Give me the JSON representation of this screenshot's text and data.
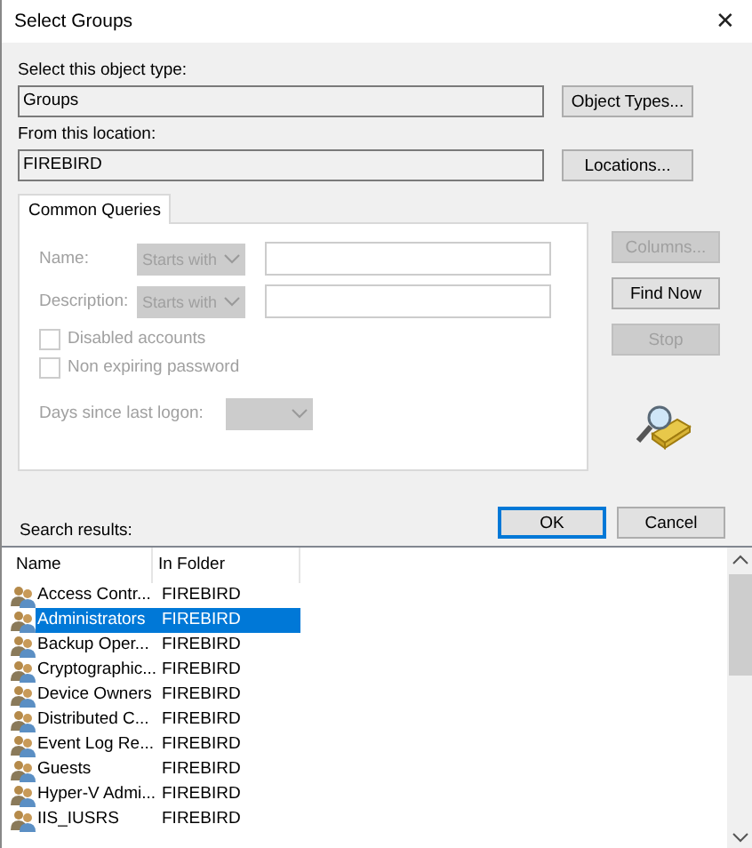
{
  "window": {
    "title": "Select Groups",
    "close": "✕"
  },
  "object_type": {
    "label": "Select this object type:",
    "value": "Groups",
    "button": "Object Types..."
  },
  "location": {
    "label": "From this location:",
    "value": "FIREBIRD",
    "button": "Locations..."
  },
  "tabs": [
    {
      "label": "Common Queries",
      "selected": true
    }
  ],
  "queries": {
    "disabled": true,
    "rows": [
      {
        "label": "Name:",
        "operator": "Starts with"
      },
      {
        "label": "Description:",
        "operator": "Starts with"
      }
    ],
    "checkboxes": [
      {
        "label": "Disabled accounts",
        "checked": false
      },
      {
        "label": "Non expiring password",
        "checked": false
      }
    ],
    "days_label": "Days since last logon:"
  },
  "side_buttons": [
    {
      "label": "Columns...",
      "disabled": true
    },
    {
      "label": "Find Now",
      "disabled": false
    },
    {
      "label": "Stop",
      "disabled": true
    }
  ],
  "buttons": [
    {
      "label": "OK",
      "default": true
    },
    {
      "label": "Cancel",
      "default": false
    }
  ],
  "results": {
    "label": "Search results:",
    "columns": [
      "Name",
      "In Folder"
    ],
    "rows": [
      {
        "name": "Access Contr...",
        "folder": "FIREBIRD",
        "selected": false
      },
      {
        "name": "Administrators",
        "folder": "FIREBIRD",
        "selected": true
      },
      {
        "name": "Backup Oper...",
        "folder": "FIREBIRD",
        "selected": false
      },
      {
        "name": "Cryptographic...",
        "folder": "FIREBIRD",
        "selected": false
      },
      {
        "name": "Device Owners",
        "folder": "FIREBIRD",
        "selected": false
      },
      {
        "name": "Distributed C...",
        "folder": "FIREBIRD",
        "selected": false
      },
      {
        "name": "Event Log Re...",
        "folder": "FIREBIRD",
        "selected": false
      },
      {
        "name": "Guests",
        "folder": "FIREBIRD",
        "selected": false
      },
      {
        "name": "Hyper-V Admi...",
        "folder": "FIREBIRD",
        "selected": false
      },
      {
        "name": "IIS_IUSRS",
        "folder": "FIREBIRD",
        "selected": false
      }
    ]
  }
}
